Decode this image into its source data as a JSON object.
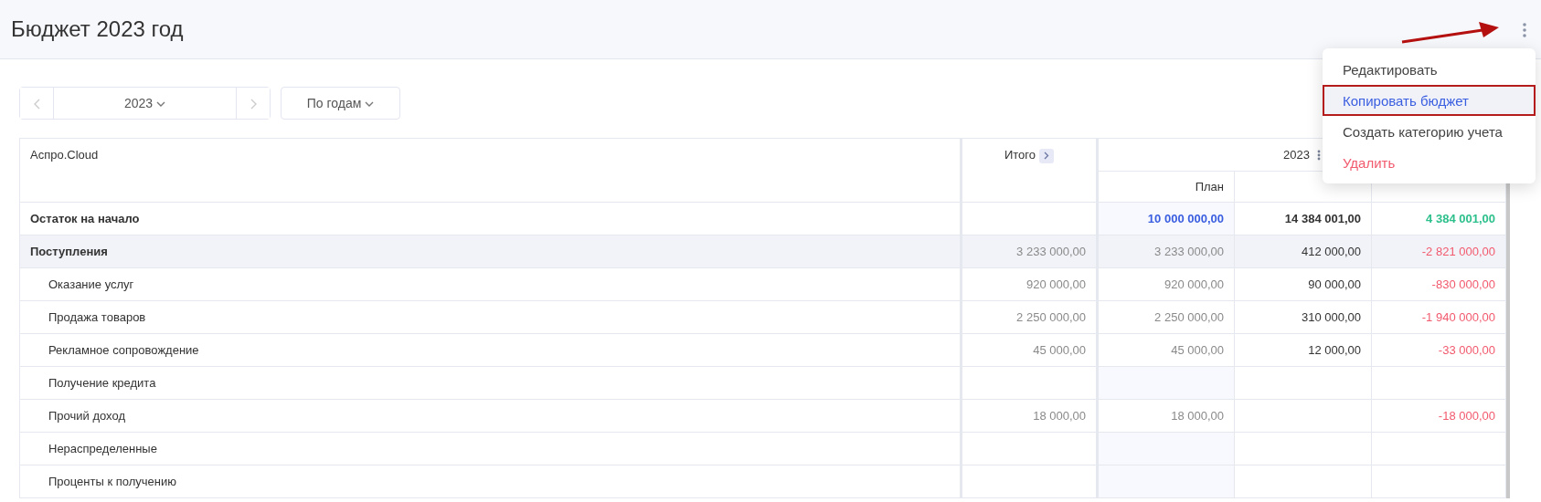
{
  "page": {
    "title": "Бюджет 2023 год"
  },
  "toolbar": {
    "year": "2023",
    "period": "По годам"
  },
  "table": {
    "corner": "Аспро.Cloud",
    "total_header": "Итого",
    "period_header": "2023",
    "sub_headers": [
      "План"
    ],
    "rows": [
      {
        "label": "Остаток на начало",
        "kind": "balance",
        "cells": [
          {},
          {
            "text": "10 000 000,00",
            "color": "#3a5ee0",
            "shaded": true
          },
          {
            "text": "14 384 001,00",
            "color": "#333333"
          },
          {
            "text": "4 384 001,00",
            "color": "#2ec08c"
          }
        ]
      },
      {
        "label": "Поступления",
        "kind": "group",
        "cells": [
          {
            "text": "3 233 000,00",
            "color": "#8a8a8a"
          },
          {
            "text": "3 233 000,00",
            "color": "#8a8a8a"
          },
          {
            "text": "412 000,00",
            "color": "#333333"
          },
          {
            "text": "-2 821 000,00",
            "color": "#f25a6e"
          }
        ]
      },
      {
        "label": "Оказание услуг",
        "kind": "item",
        "cells": [
          {
            "text": "920 000,00",
            "color": "#8a8a8a"
          },
          {
            "text": "920 000,00",
            "color": "#8a8a8a"
          },
          {
            "text": "90 000,00",
            "color": "#333333"
          },
          {
            "text": "-830 000,00",
            "color": "#f25a6e"
          }
        ]
      },
      {
        "label": "Продажа товаров",
        "kind": "item",
        "cells": [
          {
            "text": "2 250 000,00",
            "color": "#8a8a8a"
          },
          {
            "text": "2 250 000,00",
            "color": "#8a8a8a"
          },
          {
            "text": "310 000,00",
            "color": "#333333"
          },
          {
            "text": "-1 940 000,00",
            "color": "#f25a6e"
          }
        ]
      },
      {
        "label": "Рекламное сопровождение",
        "kind": "item",
        "cells": [
          {
            "text": "45 000,00",
            "color": "#8a8a8a"
          },
          {
            "text": "45 000,00",
            "color": "#8a8a8a"
          },
          {
            "text": "12 000,00",
            "color": "#333333"
          },
          {
            "text": "-33 000,00",
            "color": "#f25a6e"
          }
        ]
      },
      {
        "label": "Получение кредита",
        "kind": "item",
        "cells": [
          {},
          {
            "shaded": true
          },
          {},
          {}
        ]
      },
      {
        "label": "Прочий доход",
        "kind": "item",
        "cells": [
          {
            "text": "18 000,00",
            "color": "#8a8a8a"
          },
          {
            "text": "18 000,00",
            "color": "#8a8a8a"
          },
          {},
          {
            "text": "-18 000,00",
            "color": "#f25a6e"
          }
        ]
      },
      {
        "label": "Нераспределенные",
        "kind": "item",
        "cells": [
          {},
          {
            "shaded": true
          },
          {},
          {}
        ]
      },
      {
        "label": "Проценты к получению",
        "kind": "item",
        "cells": [
          {},
          {
            "shaded": true
          },
          {},
          {}
        ]
      }
    ]
  },
  "menu": {
    "items": [
      {
        "label": "Редактировать",
        "kind": "normal",
        "selected": false
      },
      {
        "label": "Копировать бюджет",
        "kind": "normal",
        "selected": true
      },
      {
        "label": "Создать категорию учета",
        "kind": "normal",
        "selected": false
      },
      {
        "label": "Удалить",
        "kind": "danger",
        "selected": false
      }
    ]
  }
}
